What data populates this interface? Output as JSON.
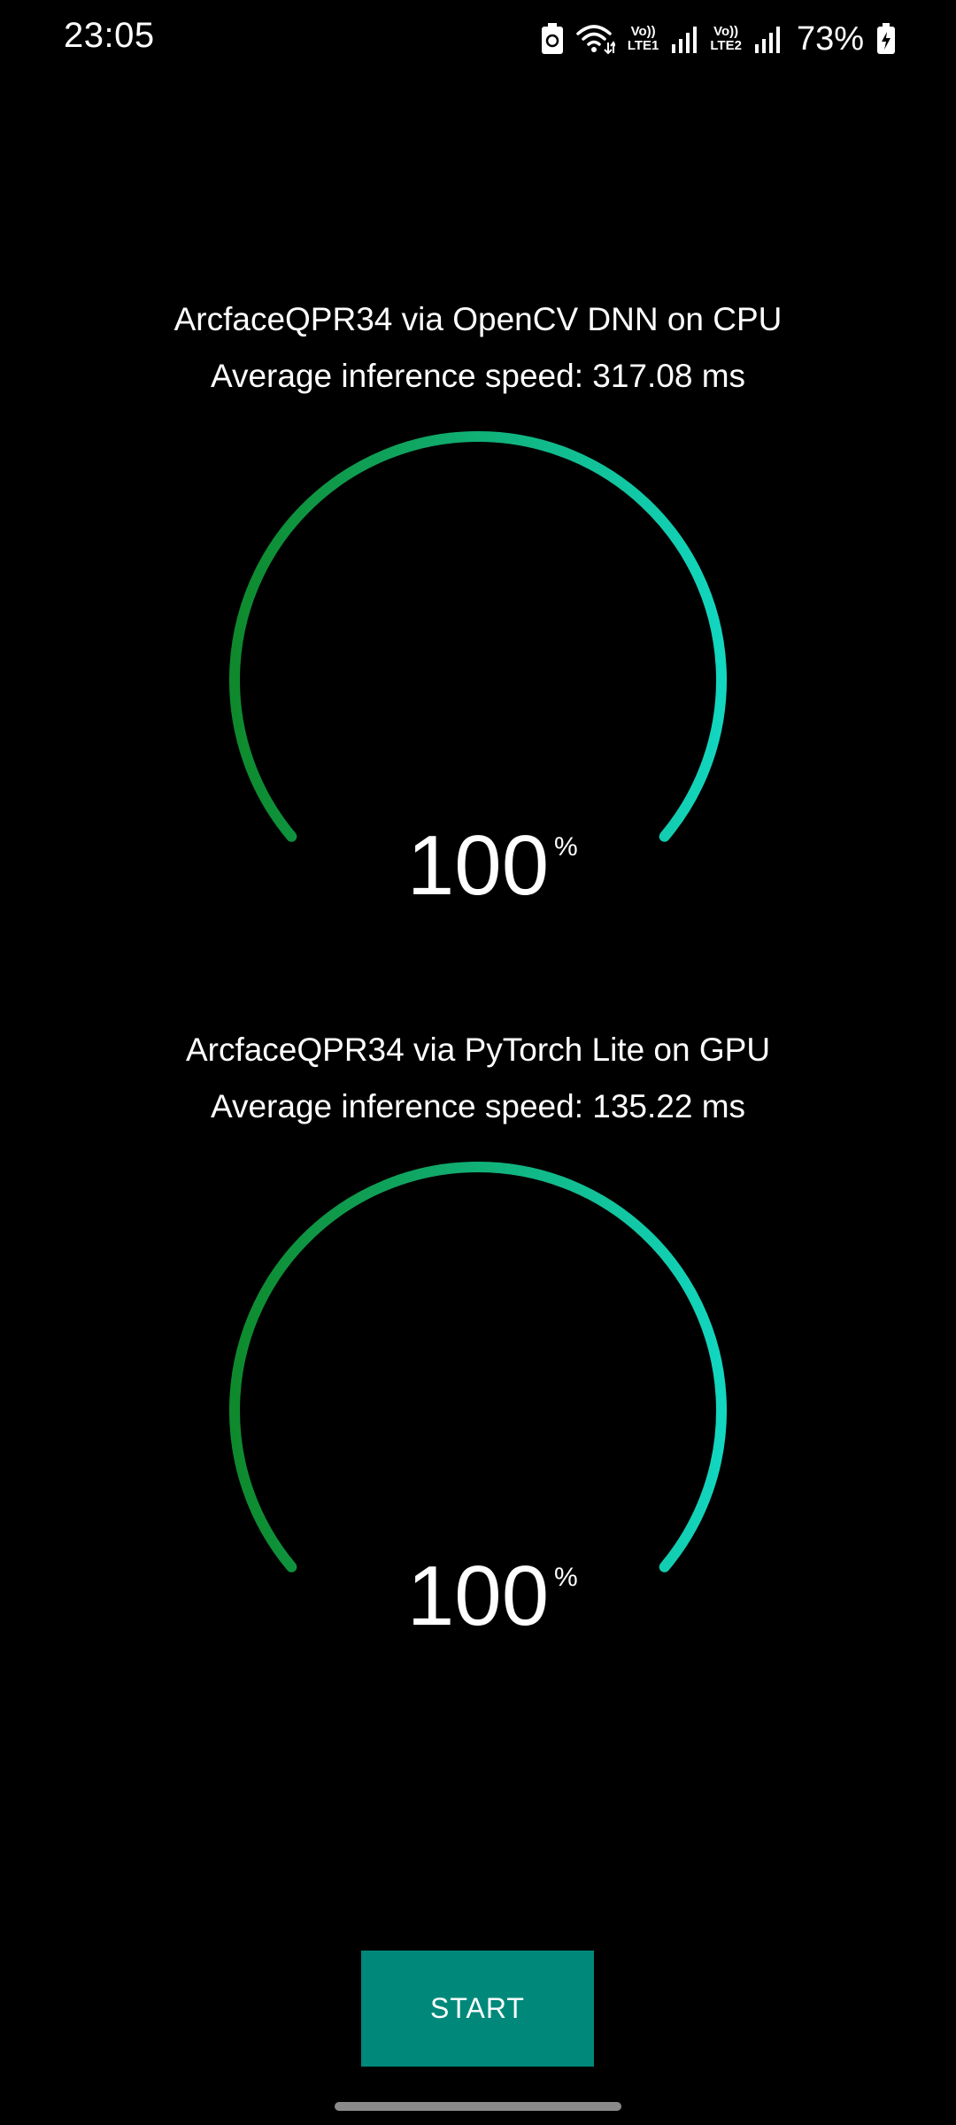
{
  "status_bar": {
    "time": "23:05",
    "sim1_top": "Vo))",
    "sim1_bottom": "LTE1",
    "sim2_top": "Vo))",
    "sim2_bottom": "LTE2",
    "battery_percent": "73%",
    "icons": [
      "battery-saver-icon",
      "wifi-icon",
      "signal-icon",
      "signal-icon",
      "battery-charging-icon"
    ]
  },
  "gauges": [
    {
      "title": "ArcfaceQPR34 via OpenCV DNN on CPU",
      "speed": "Average inference speed: 317.08 ms",
      "value": "100",
      "unit": "%",
      "progress": 1.0
    },
    {
      "title": "ArcfaceQPR34 via PyTorch Lite on GPU",
      "speed": "Average inference speed: 135.22 ms",
      "value": "100",
      "unit": "%",
      "progress": 1.0
    }
  ],
  "colors": {
    "background": "#000000",
    "gauge_start": "#0e8a2c",
    "gauge_end": "#12d6c0",
    "button": "#00897b",
    "text": "#ffffff"
  },
  "start_button": {
    "label": "START"
  }
}
